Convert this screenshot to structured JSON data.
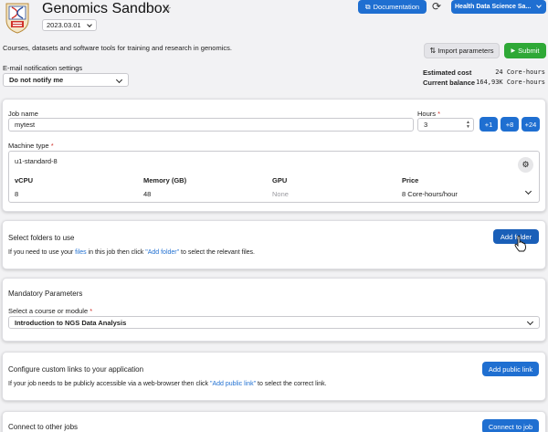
{
  "app": {
    "title": "Genomics Sandbox",
    "version": "2023.03.01",
    "description": "Courses, datasets and software tools for training and research in genomics."
  },
  "header": {
    "documentation_label": "Documentation",
    "project_label": "Health Data Science Sa...",
    "import_label": "Import parameters",
    "submit_label": "Submit"
  },
  "notifications": {
    "label": "E-mail notification settings",
    "value": "Do not notify me"
  },
  "billing": {
    "estimated_cost_label": "Estimated cost",
    "estimated_cost_value": "24 Core-hours",
    "balance_label": "Current balance",
    "balance_value": "164,93K Core-hours"
  },
  "job": {
    "name_label": "Job name",
    "name_value": "mytest",
    "hours_label": "Hours",
    "hours_value": "3",
    "plus1": "+1",
    "plus8": "+8",
    "plus24": "+24",
    "machine_label": "Machine type",
    "machine_value": "u1-standard-8",
    "columns": [
      "vCPU",
      "Memory (GB)",
      "GPU",
      "Price"
    ],
    "values": [
      "8",
      "48",
      "None",
      "8 Core-hours/hour"
    ]
  },
  "folders": {
    "title": "Select folders to use",
    "button": "Add folder",
    "text_before": "If you need to use your ",
    "link1": "files",
    "text_middle": " in this job then click ",
    "link2": "\"Add folder\"",
    "text_after": " to select the relevant files."
  },
  "mandatory": {
    "title": "Mandatory Parameters",
    "course_label": "Select a course or module",
    "course_value": "Introduction to NGS Data Analysis"
  },
  "links": {
    "title": "Configure custom links to your application",
    "button": "Add public link",
    "text_before": "If your job needs to be publicly accessible via a web-browser then click ",
    "link": "\"Add public link\"",
    "text_after": " to select the correct link."
  },
  "connect": {
    "title": "Connect to other jobs",
    "button": "Connect to job"
  },
  "icons": {
    "star": "star-outline-icon",
    "refresh": "refresh-icon",
    "external": "external-link-icon",
    "import": "import-arrows-icon",
    "submit": "play-icon",
    "machine": "machine-settings-icon",
    "cursor": "hand-pointer-icon"
  },
  "colors": {
    "primary": "#1f6fd1",
    "success": "#2ea836",
    "required": "#d0322b"
  }
}
